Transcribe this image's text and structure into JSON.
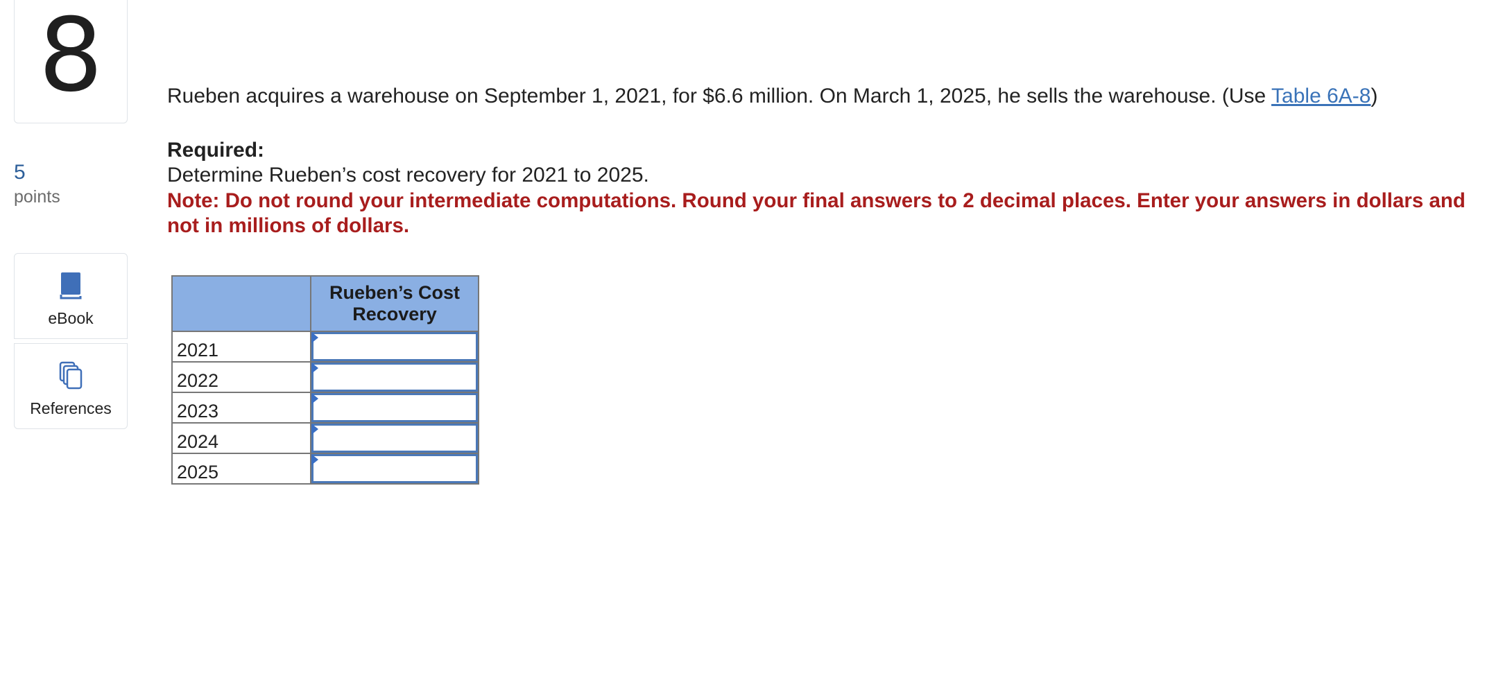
{
  "question": {
    "number": "8",
    "points_value": "5",
    "points_label": "points",
    "text_before_link": "Rueben acquires a warehouse on September 1, 2021, for $6.6 million. On March 1, 2025, he sells the warehouse. (Use ",
    "link_text": "Table 6A-8",
    "text_after_link": ")",
    "required_label": "Required:",
    "instruction": "Determine Rueben’s cost recovery for 2021 to 2025.",
    "note": "Note: Do not round your intermediate computations. Round your final answers to 2 decimal places. Enter your answers in dollars and not in millions of dollars."
  },
  "tools": {
    "ebook": {
      "label": "eBook",
      "icon": "book-icon"
    },
    "references": {
      "label": "References",
      "icon": "copy-icon"
    }
  },
  "table": {
    "header_year": "",
    "header_value": "Rueben’s Cost Recovery",
    "rows": [
      {
        "year": "2021",
        "value": ""
      },
      {
        "year": "2022",
        "value": ""
      },
      {
        "year": "2023",
        "value": ""
      },
      {
        "year": "2024",
        "value": ""
      },
      {
        "year": "2025",
        "value": ""
      }
    ]
  },
  "colors": {
    "link": "#3a73b8",
    "note": "#a81d1d",
    "table_header": "#8aafe3",
    "input_border": "#4a78b8",
    "points": "#2d5f9a"
  }
}
